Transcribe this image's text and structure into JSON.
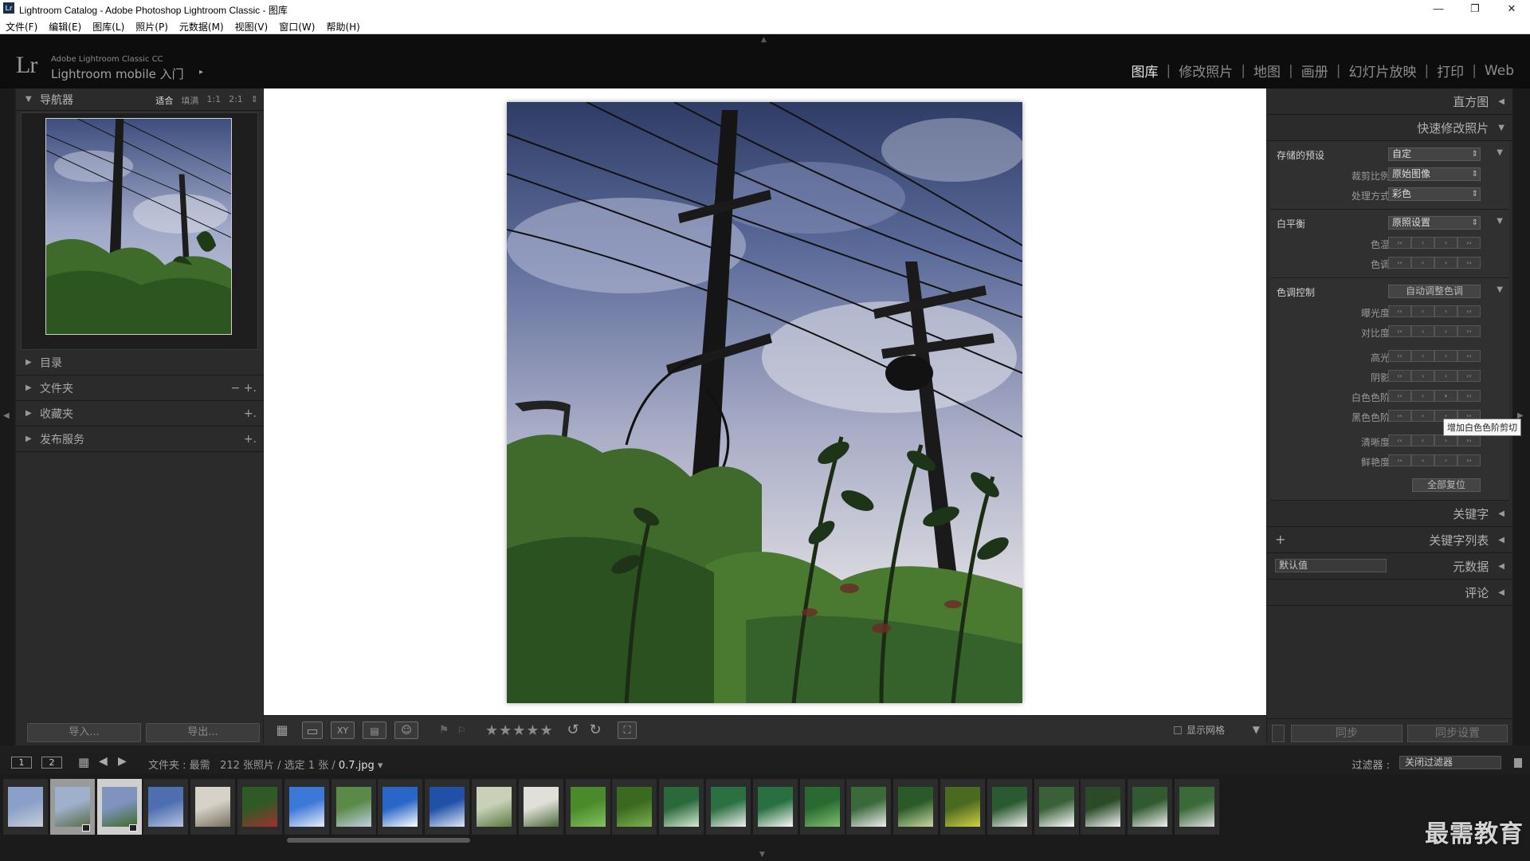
{
  "window": {
    "title": "Lightroom Catalog - Adobe Photoshop Lightroom Classic - 图库",
    "icon": "Lr",
    "controls": [
      "—",
      "❐",
      "✕"
    ]
  },
  "menu": [
    "文件(F)",
    "编辑(E)",
    "图库(L)",
    "照片(P)",
    "元数据(M)",
    "视图(V)",
    "窗口(W)",
    "帮助(H)"
  ],
  "identity": {
    "logo": "Lr",
    "small": "Adobe Lightroom Classic CC",
    "big": "Lightroom mobile 入门",
    "arrow": "▸"
  },
  "modules": {
    "items": [
      "图库",
      "修改照片",
      "地图",
      "画册",
      "幻灯片放映",
      "打印",
      "Web"
    ],
    "active": "图库",
    "separator": "|"
  },
  "navigator": {
    "title": "导航器",
    "zoom": [
      "适合",
      "填满",
      "1:1",
      "2:1",
      "⇕"
    ],
    "zoom_active": "适合"
  },
  "left_sections": [
    {
      "label": "目录",
      "actions": ""
    },
    {
      "label": "文件夹",
      "actions": "−  +."
    },
    {
      "label": "收藏夹",
      "actions": "+."
    },
    {
      "label": "发布服务",
      "actions": "+."
    }
  ],
  "left_buttons": {
    "import": "导入...",
    "export": "导出..."
  },
  "toolbar": {
    "stars": "★★★★★",
    "show_grid": "显示网格",
    "view_icons": [
      "grid-view-icon",
      "loupe-view-icon",
      "compare-view-icon",
      "survey-view-icon",
      "people-view-icon"
    ]
  },
  "right_panel": {
    "histogram": "直方图",
    "quick_develop": "快速修改照片",
    "saved_preset": {
      "label": "存储的预设",
      "value": "自定"
    },
    "crop_ratio": {
      "label": "裁剪比例",
      "value": "原始图像"
    },
    "treatment": {
      "label": "处理方式",
      "value": "彩色"
    },
    "white_balance": {
      "label": "白平衡",
      "value": "原照设置"
    },
    "wb_rows": [
      "色温",
      "色调"
    ],
    "tone_control": {
      "label": "色调控制",
      "button": "自动调整色调"
    },
    "tone_rows_a": [
      "曝光度",
      "对比度"
    ],
    "tone_rows_b": [
      "高光",
      "阴影",
      "白色色阶",
      "黑色色阶"
    ],
    "tone_rows_c": [
      "清晰度",
      "鲜艳度"
    ],
    "step_glyphs": [
      "‹‹",
      "‹",
      "›",
      "››"
    ],
    "reset_all": "全部复位",
    "keywording": "关键字",
    "keyword_list": "关键字列表",
    "metadata": "元数据",
    "metadata_preset": "默认值",
    "comments": "评论",
    "sync": "同步",
    "sync_settings": "同步设置"
  },
  "tooltip": "增加白色色阶剪切",
  "filmstrip_bar": {
    "screen1": "1",
    "screen2": "2",
    "source_prefix": "文件夹 : 最需",
    "count": "212 张照片 / 选定 1 张 /",
    "filename": "0.7.jpg",
    "filter_label": "过滤器 :",
    "filter_value": "关闭过滤器"
  },
  "filmstrip": {
    "thumb_count": 26,
    "selected_index": 2,
    "badges": [
      1,
      2
    ]
  },
  "watermark": "最需教育",
  "colors": {
    "panel_bg": "#2b2b2b",
    "accent_active": "#e6e6e6",
    "sky": "#7f93bd",
    "foliage": "#3e6b2a"
  }
}
